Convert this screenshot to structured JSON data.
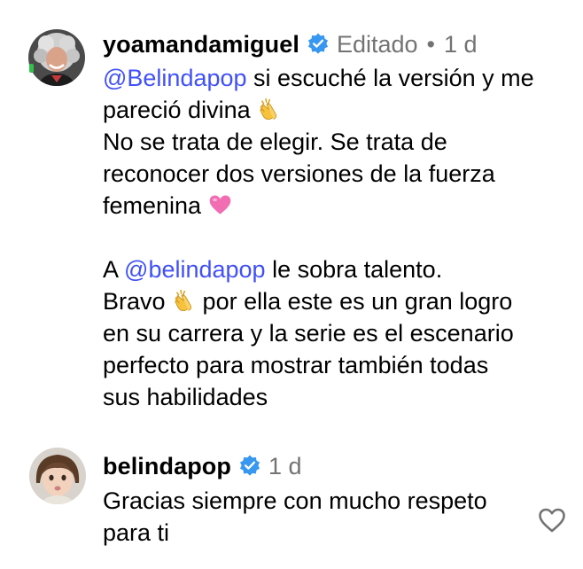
{
  "comments": [
    {
      "username": "yoamandamiguel",
      "edited_label": "Editado",
      "separator": "•",
      "time": "1 d",
      "lines": [
        {
          "mention": "@Belindapop",
          "text": " si escuché la versión y me"
        },
        {
          "text": "pareció divina ",
          "emoji": "clapping-hands-emoji"
        },
        {
          "text": "No se trata de elegir. Se trata de"
        },
        {
          "text": "reconocer dos versiones de la fuerza"
        },
        {
          "text": "femenina ",
          "emoji": "pink-heart-emoji"
        },
        {
          "blank": true
        },
        {
          "prefix": "A ",
          "mention": "@belindapop",
          "text": " le sobra talento."
        },
        {
          "text_before": "Bravo ",
          "emoji": "clapping-hands-emoji",
          "text": " por ella este es un gran logro"
        },
        {
          "text": "en su carrera y la serie es el escenario"
        },
        {
          "text": "perfecto para mostrar también todas"
        },
        {
          "text": "sus habilidades"
        }
      ]
    },
    {
      "username": "belindapop",
      "time": "1 d",
      "lines": [
        {
          "text": "Gracias siempre con mucho respeto"
        },
        {
          "text": "para ti"
        }
      ],
      "like_icon": "heart-outline-icon"
    }
  ],
  "colors": {
    "mention": "#4150f7",
    "verified": "#3897f0",
    "meta": "#737373",
    "text": "#000000",
    "background": "#ffffff"
  }
}
